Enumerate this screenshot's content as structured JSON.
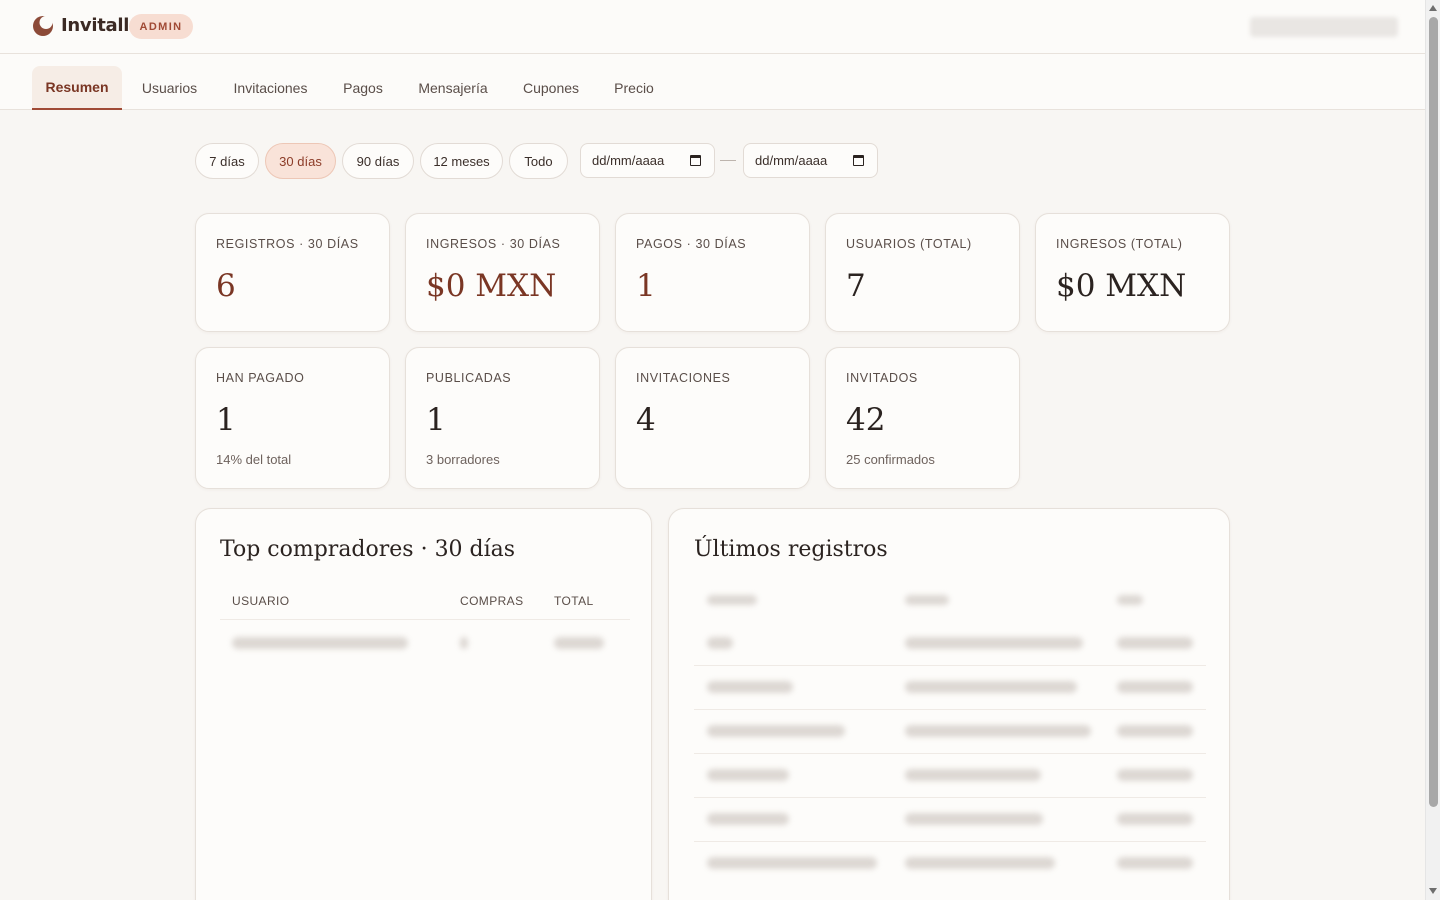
{
  "app": {
    "name": "Invitall",
    "badge": "ADMIN"
  },
  "nav": {
    "tabs": [
      {
        "label": "Resumen",
        "active": true
      },
      {
        "label": "Usuarios"
      },
      {
        "label": "Invitaciones"
      },
      {
        "label": "Pagos"
      },
      {
        "label": "Mensajería"
      },
      {
        "label": "Cupones"
      },
      {
        "label": "Precio"
      }
    ]
  },
  "filters": {
    "ranges": [
      "7 días",
      "30 días",
      "90 días",
      "12 meses",
      "Todo"
    ],
    "active_range": "30 días",
    "date_from_placeholder": "dd/mm/aaaa",
    "date_to_placeholder": "dd/mm/aaaa"
  },
  "stats": {
    "registros": {
      "label": "Registros · 30 días",
      "value": "6"
    },
    "ingresos_periodo": {
      "label": "Ingresos · 30 días",
      "value": "$0 MXN"
    },
    "pagos": {
      "label": "Pagos · 30 días",
      "value": "1"
    },
    "usuarios_total": {
      "label": "Usuarios (total)",
      "value": "7"
    },
    "ingresos_total": {
      "label": "Ingresos (total)",
      "value": "$0 MXN"
    },
    "han_pagado": {
      "label": "Han pagado",
      "value": "1",
      "sub": "14% del total"
    },
    "publicadas": {
      "label": "Publicadas",
      "value": "1",
      "sub": "3 borradores"
    },
    "invitaciones": {
      "label": "Invitaciones",
      "value": "4"
    },
    "invitados": {
      "label": "Invitados",
      "value": "42",
      "sub": "25 confirmados"
    }
  },
  "top_buyers": {
    "title": "Top compradores · 30 días",
    "columns": [
      "Usuario",
      "Compras",
      "Total"
    ]
  },
  "latest": {
    "title": "Últimos registros"
  },
  "colors": {
    "accent": "#7a3624",
    "badge_bg": "#f7ddd2",
    "background": "#f8f6f3"
  }
}
